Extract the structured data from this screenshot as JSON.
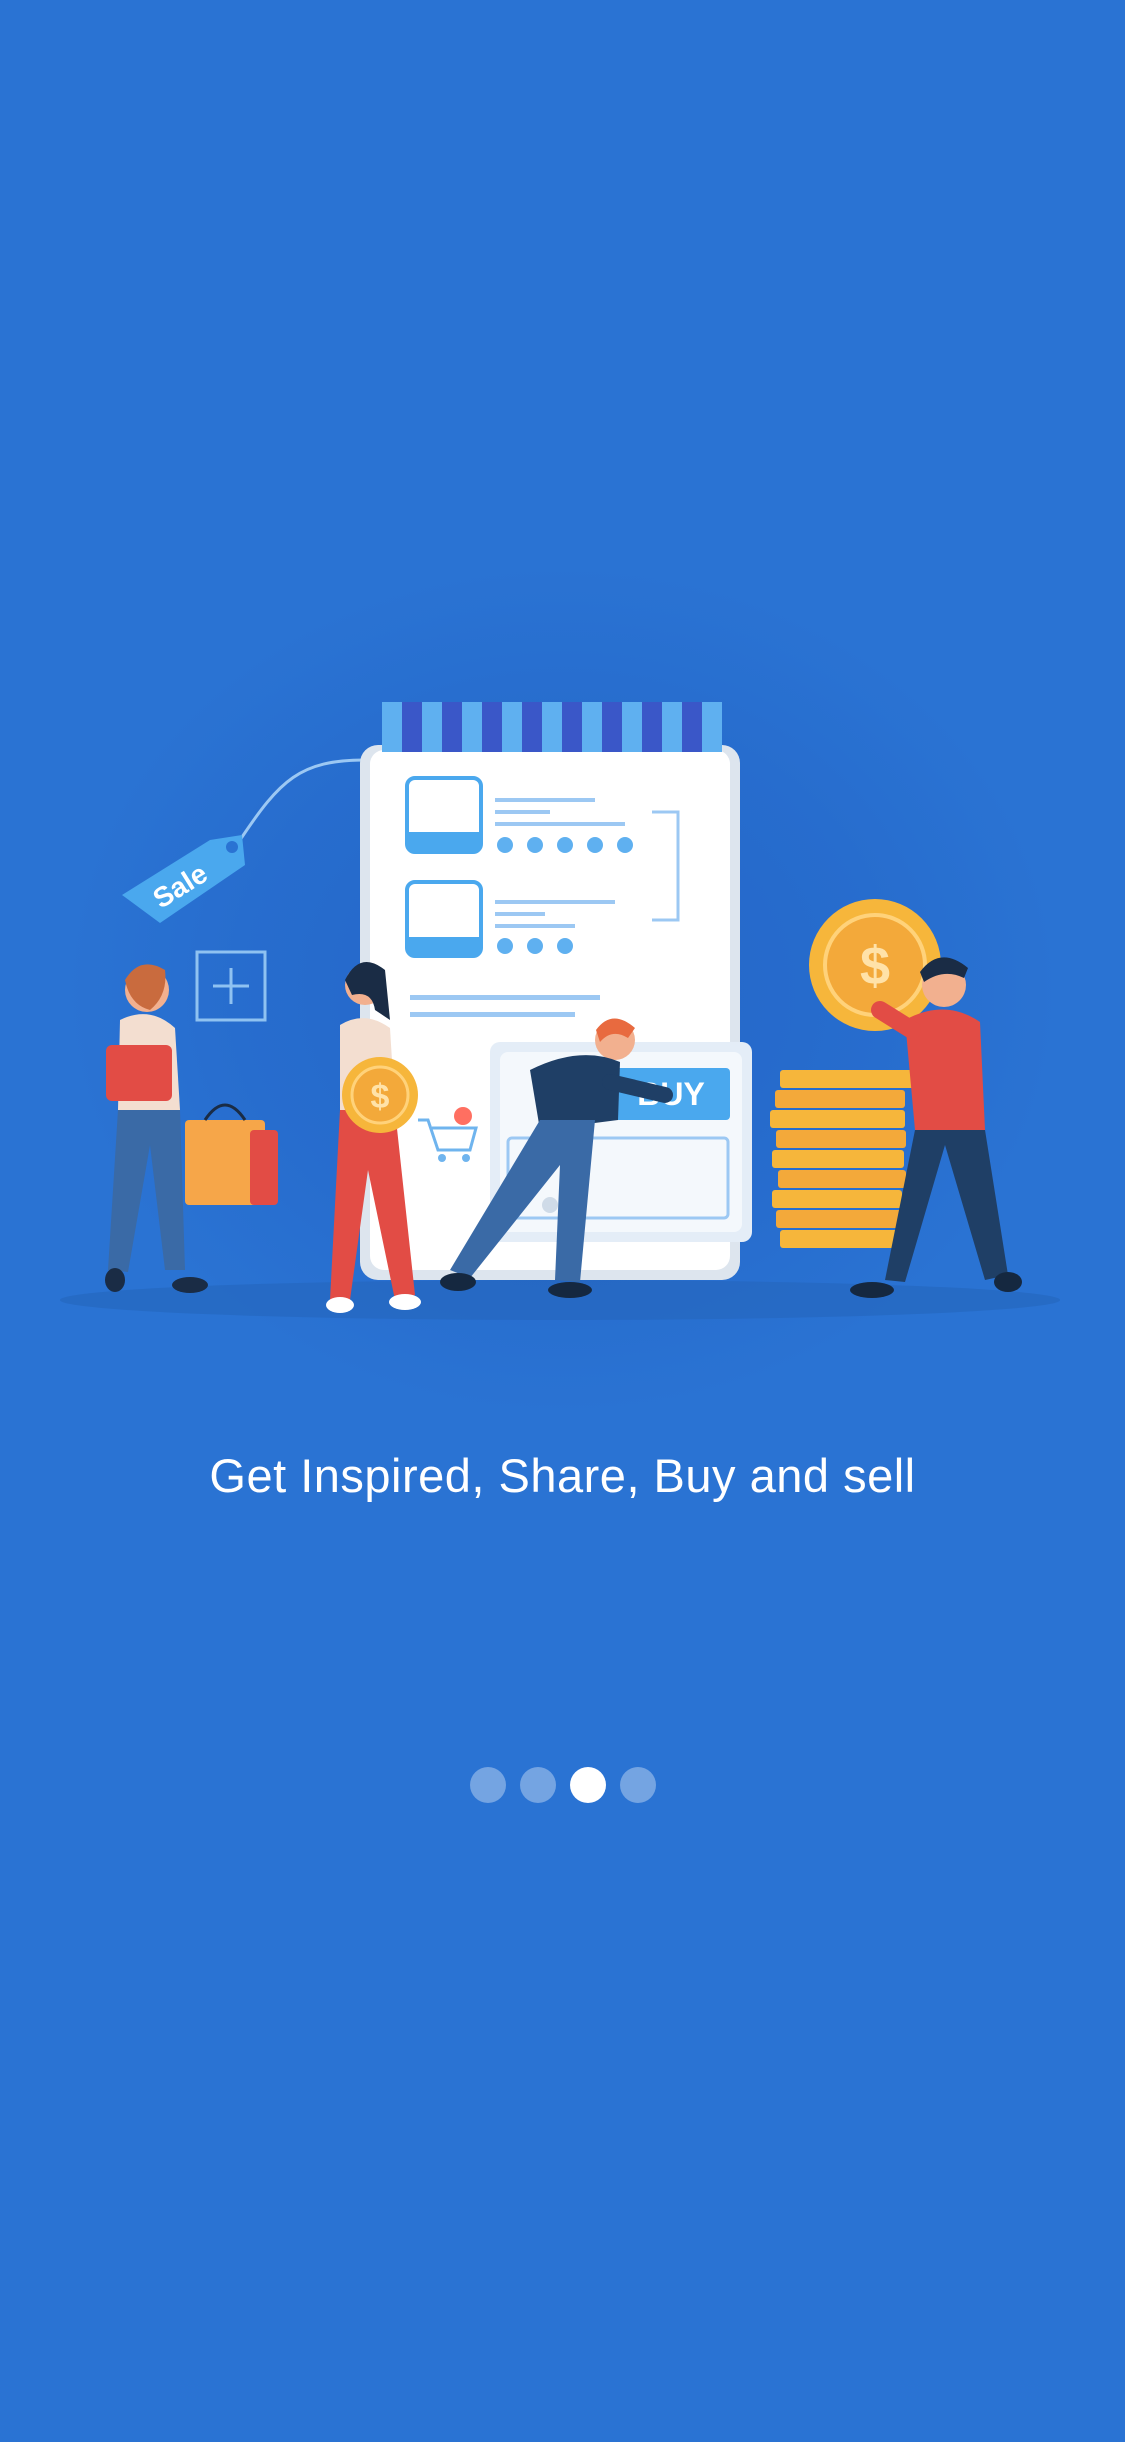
{
  "onboarding": {
    "headline": "Get Inspired, Share, Buy and sell",
    "illustration": {
      "sale_tag_text": "Sale",
      "buy_button_text": "BUY",
      "currency_symbol": "$"
    },
    "pager": {
      "total": 4,
      "current": 3
    }
  },
  "colors": {
    "background": "#2a73d3",
    "accent_light_blue": "#4aa8ee",
    "coin_orange": "#f3a93a",
    "person_red": "#e24c45",
    "navy": "#1f3f66"
  }
}
